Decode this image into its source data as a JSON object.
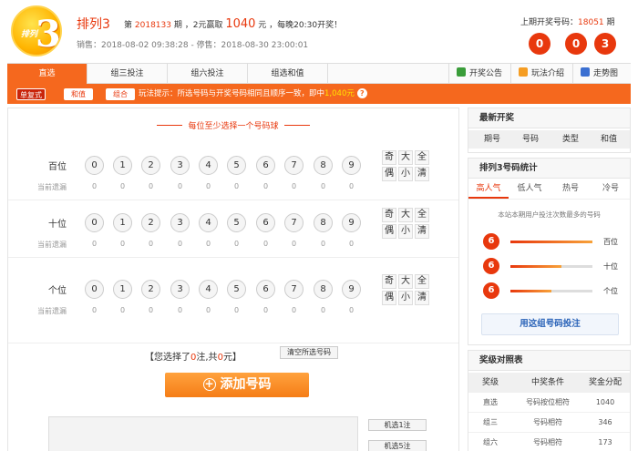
{
  "header": {
    "logo_text": "排列",
    "logo_num": "3",
    "game_name": "排列3",
    "issue_prefix": "第",
    "issue_no": "2018133",
    "issue_suffix": "期 ，2元赢取",
    "prize": "1040",
    "prize_suffix": "元 ，每晚20:30开奖！",
    "sale_time": "销售：2018-08-02 09:38:28 - 停售：2018-08-30 23:00:01",
    "last_label": "上期开奖号码：",
    "last_issue": "18051",
    "last_issue_suffix": "期",
    "last_balls": [
      "0",
      "0",
      "3"
    ]
  },
  "tabs": {
    "items": [
      "直选",
      "组三投注",
      "组六投注",
      "组选和值"
    ],
    "links": [
      "开奖公告",
      "玩法介绍",
      "走势图"
    ]
  },
  "hintbar": {
    "pills": [
      "单复式",
      "和值",
      "组合"
    ],
    "hint_text": "玩法提示：所选号码与开奖号码相同且顺序一致，即中",
    "hint_amount": "1,040元",
    "help_icon": "?"
  },
  "picker": {
    "title": "每位至少选择一个号码球",
    "rows": [
      {
        "label": "百位",
        "miss_label": "当前遗漏"
      },
      {
        "label": "十位",
        "miss_label": "当前遗漏"
      },
      {
        "label": "个位",
        "miss_label": "当前遗漏"
      }
    ],
    "numbers": [
      "0",
      "1",
      "2",
      "3",
      "4",
      "5",
      "6",
      "7",
      "8",
      "9"
    ],
    "miss_values": [
      "0",
      "0",
      "0",
      "0",
      "0",
      "0",
      "0",
      "0",
      "0",
      "0"
    ],
    "quick_top": [
      "奇",
      "大",
      "全"
    ],
    "quick_bottom": [
      "偶",
      "小",
      "清"
    ],
    "summary_a": "【您选择了",
    "summary_count": "0",
    "summary_b": "注,共",
    "summary_amount": "0",
    "summary_c": "元】",
    "clear_label": "清空所选号码",
    "add_label": "添加号码",
    "random_buttons": [
      "机选1注",
      "机选5注"
    ]
  },
  "latest": {
    "title": "最新开奖",
    "cols": [
      "期号",
      "号码",
      "类型",
      "和值"
    ]
  },
  "stats": {
    "title": "排列3号码统计",
    "tabs": [
      "高人气",
      "低人气",
      "热号",
      "冷号"
    ],
    "note": "本站本期用户投注次数最多的号码",
    "rows": [
      {
        "ball": "6",
        "label": "百位",
        "pct": 1.0
      },
      {
        "ball": "6",
        "label": "十位",
        "pct": 0.62
      },
      {
        "ball": "6",
        "label": "个位",
        "pct": 0.5
      }
    ],
    "bet_label": "用这组号码投注"
  },
  "prizes": {
    "title": "奖级对照表",
    "cols": [
      "奖级",
      "中奖条件",
      "奖金分配"
    ],
    "rows": [
      [
        "直选",
        "号码按位相符",
        "1040"
      ],
      [
        "组三",
        "号码相符",
        "346"
      ],
      [
        "组六",
        "号码相符",
        "173"
      ]
    ]
  },
  "colors": {
    "accent": "#f5681e",
    "red": "#e8380d",
    "link_blue": "#2a63b8"
  }
}
